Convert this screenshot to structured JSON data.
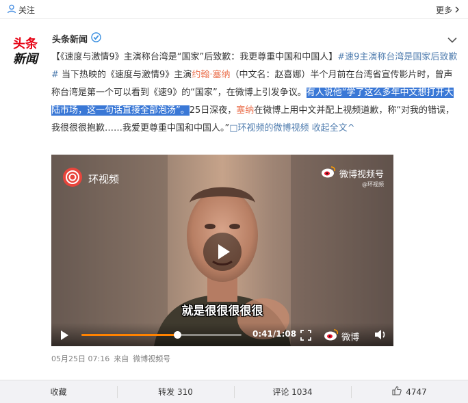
{
  "header": {
    "follow_label": "关注",
    "more_label": "更多"
  },
  "author": {
    "name": "头条新闻",
    "logo_line1": "头条",
    "logo_line2": "新闻"
  },
  "post": {
    "p1": "【《速度与激情9》主演称台湾是“国家”后致歉：我更尊重中国和中国人】",
    "p2_topic": "#速9主演称台湾是国家后致歉#",
    "p3": " 当下热映的《速度与激情9》主演",
    "p4_name": "约翰·塞纳",
    "p5": "（中文名：赵喜娜）半个月前在台湾省宣传影片时，曾声称台湾是第一个可以看到《速9》的“国家”，在微博上引发争议。",
    "p6_selected": "有人说他“学了这么多年中文想打开大陆市场，这一句话直接全部泡汤”。",
    "p7": "25日深夜，",
    "p8_name": "塞纳",
    "p9": "在微博上用中文并配上视频道歉，称“对我的错误，我很很很抱歉……我爱更尊重中国和中国人。”",
    "p10_video_link": "□环视频的微博视频",
    "p11_collapse": " 收起全文",
    "p11_arrow": "^"
  },
  "video": {
    "source_logo": "环视频",
    "watermark_title": "微博视频号",
    "watermark_sub": "@环视频",
    "subtitle": "就是很很很很很",
    "current_time": "0:41",
    "total_time": "1:08",
    "progress": 0.6,
    "brand": "微博"
  },
  "meta": {
    "date": "05月25日 07:16",
    "source_prefix": "来自",
    "source": "微博视频号"
  },
  "actions": {
    "favorite": "收藏",
    "repost": "转发 310",
    "comment": "评论 1034",
    "like": "4747"
  },
  "colors": {
    "link": "#eb7350",
    "topic": "#507daf",
    "selection": "#3a78d6",
    "progress": "#ff8200"
  }
}
